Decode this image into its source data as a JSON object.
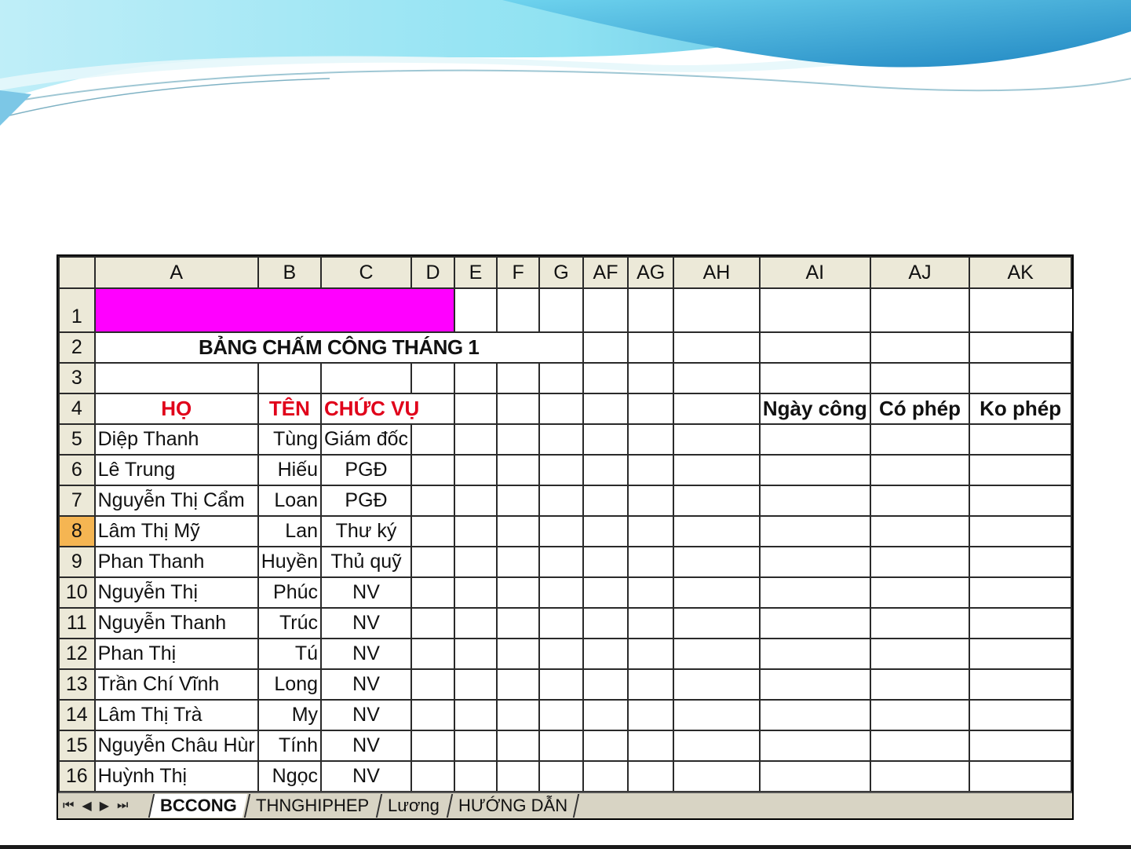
{
  "colors": {
    "magenta": "#ff00ff",
    "header_red": "#e0001a",
    "selected_row": "#f5b552",
    "header_bg": "#ece9d8"
  },
  "columns": [
    "A",
    "B",
    "C",
    "D",
    "E",
    "F",
    "G",
    "AF",
    "AG",
    "AH",
    "AI",
    "AJ",
    "AK"
  ],
  "title": "BẢNG CHẤM CÔNG THÁNG 1",
  "headers": {
    "ho": "HỌ",
    "ten": "TÊN",
    "chuc_vu": "CHỨC VỤ",
    "ngay_cong": "Ngày công",
    "co_phep": "Có phép",
    "ko_phep": "Ko phép"
  },
  "selected_row": 8,
  "employees": [
    {
      "row": 5,
      "ho": "Diệp Thanh",
      "ten": "Tùng",
      "chuc_vu": "Giám đốc"
    },
    {
      "row": 6,
      "ho": "Lê Trung",
      "ten": "Hiếu",
      "chuc_vu": "PGĐ"
    },
    {
      "row": 7,
      "ho": "Nguyễn Thị Cẩm",
      "ten": "Loan",
      "chuc_vu": "PGĐ"
    },
    {
      "row": 8,
      "ho": "Lâm Thị Mỹ",
      "ten": "Lan",
      "chuc_vu": "Thư ký"
    },
    {
      "row": 9,
      "ho": "Phan Thanh",
      "ten": "Huyền",
      "chuc_vu": "Thủ quỹ"
    },
    {
      "row": 10,
      "ho": "Nguyễn Thị",
      "ten": "Phúc",
      "chuc_vu": "NV"
    },
    {
      "row": 11,
      "ho": "Nguyễn Thanh",
      "ten": "Trúc",
      "chuc_vu": "NV"
    },
    {
      "row": 12,
      "ho": "Phan Thị",
      "ten": "Tú",
      "chuc_vu": "NV"
    },
    {
      "row": 13,
      "ho": "Trần Chí Vĩnh",
      "ten": "Long",
      "chuc_vu": "NV"
    },
    {
      "row": 14,
      "ho": "Lâm Thị Trà",
      "ten": "My",
      "chuc_vu": "NV"
    },
    {
      "row": 15,
      "ho": "Nguyễn Châu Hùr",
      "ten": "Tính",
      "chuc_vu": "NV"
    },
    {
      "row": 16,
      "ho": "Huỳnh Thị",
      "ten": "Ngọc",
      "chuc_vu": "NV"
    }
  ],
  "sheet_tabs": [
    "BCCONG",
    "THNGHIPHEP",
    "Lương",
    "HƯỚNG DẪN"
  ],
  "active_tab": "BCCONG"
}
